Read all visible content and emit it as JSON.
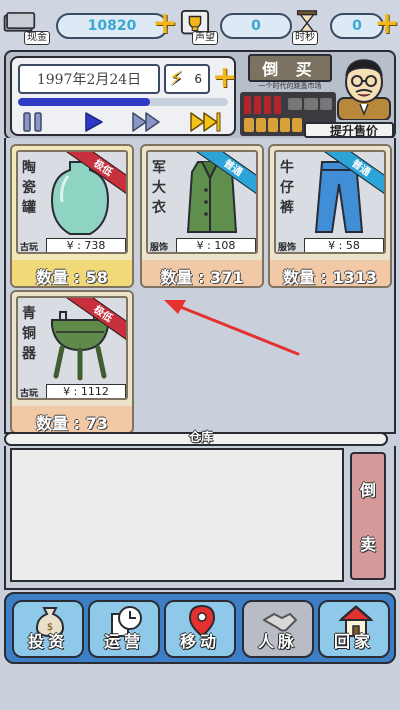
{
  "top_bar": {
    "cash": {
      "label": "现金",
      "value": "10820"
    },
    "reputation": {
      "label": "声望",
      "value": "0"
    },
    "time": {
      "label": "时秒",
      "value": "0"
    }
  },
  "header": {
    "date": "1997年2月24日",
    "speed": "6",
    "progress": 0.63,
    "shop_sign": "倒 买",
    "shop_subtitle": "一个时代的跳蚤市场",
    "upgrade_label": "提升售价"
  },
  "inventory": {
    "items": [
      {
        "name_chars": [
          "陶",
          "瓷",
          "罐"
        ],
        "tag": "极低",
        "tag_color": "#c8303d",
        "category": "古玩",
        "price": "¥ : 738",
        "quantity": "数量 : 58",
        "rarity": "legend"
      },
      {
        "name_chars": [
          "军",
          "大",
          "衣"
        ],
        "tag": "普通",
        "tag_color": "#2da4d7",
        "category": "服饰",
        "price": "¥ : 108",
        "quantity": "数量 : 371",
        "rarity": "normal"
      },
      {
        "name_chars": [
          "牛",
          "仔",
          "裤"
        ],
        "tag": "普通",
        "tag_color": "#2da4d7",
        "category": "服饰",
        "price": "¥ : 58",
        "quantity": "数量 : 1313",
        "rarity": "normal"
      },
      {
        "name_chars": [
          "青",
          "铜",
          "器"
        ],
        "tag": "极低",
        "tag_color": "#c8303d",
        "category": "古玩",
        "price": "¥ : 1112",
        "quantity": "数量 : 73",
        "rarity": "normal"
      }
    ]
  },
  "warehouse": {
    "label": "仓库",
    "sell_chars": [
      "倒",
      "卖"
    ]
  },
  "bottom_nav": [
    {
      "label": "投资",
      "icon": "money-bag-icon",
      "enabled": true
    },
    {
      "label": "运营",
      "icon": "clock-document-icon",
      "enabled": true
    },
    {
      "label": "移动",
      "icon": "map-pin-icon",
      "enabled": true
    },
    {
      "label": "人脉",
      "icon": "handshake-icon",
      "enabled": false
    },
    {
      "label": "回家",
      "icon": "house-icon",
      "enabled": true
    }
  ]
}
